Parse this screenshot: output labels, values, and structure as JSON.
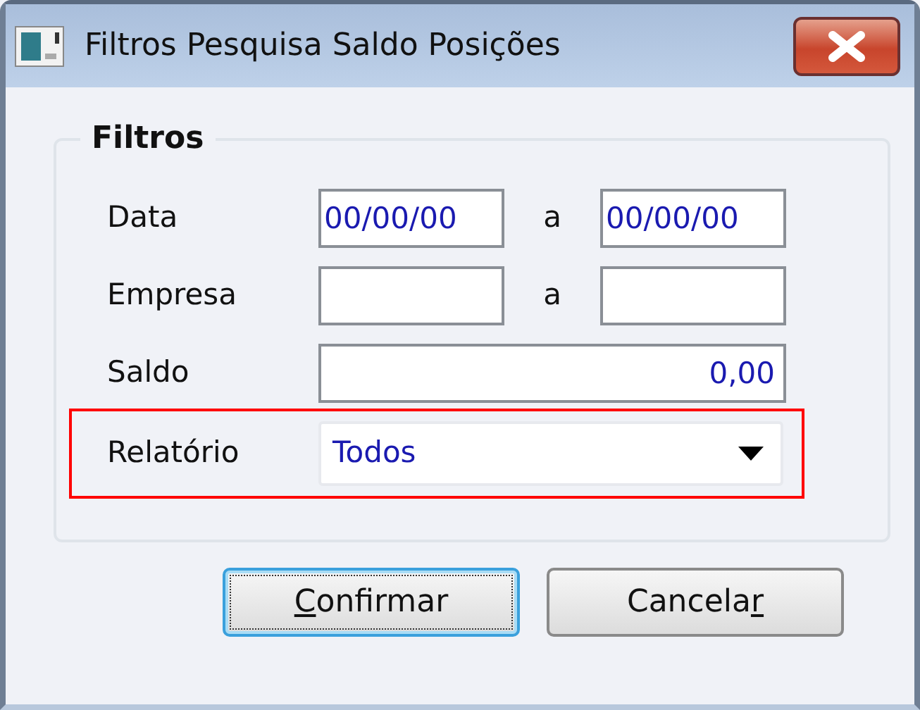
{
  "window": {
    "title": "Filtros Pesquisa Saldo Posições"
  },
  "group": {
    "title": "Filtros"
  },
  "rows": [
    {
      "kind": "range",
      "label": "Data",
      "from": "00/00/00",
      "separator": "a",
      "to": "00/00/00",
      "highlighted": false
    },
    {
      "kind": "range",
      "label": "Empresa",
      "separator": "a",
      "highlighted": false
    },
    {
      "kind": "number",
      "label": "Saldo",
      "value": "0,00",
      "highlighted": false
    },
    {
      "kind": "select",
      "label": "Relatório",
      "value": "Todos",
      "highlighted": true
    }
  ],
  "buttons": [
    {
      "mnemonic": "C",
      "after": "onfirmar",
      "focused": true
    },
    {
      "before": "Cancela",
      "mnemonic": "r",
      "focused": false
    }
  ]
}
